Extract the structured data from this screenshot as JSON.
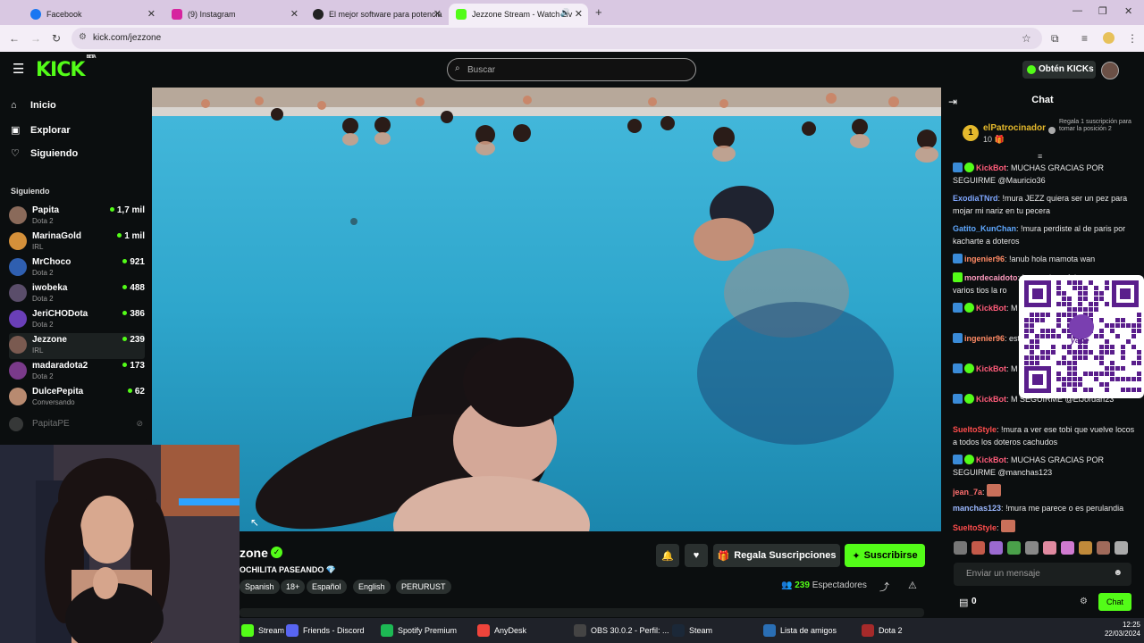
{
  "browser": {
    "tabs": [
      {
        "title": "Facebook",
        "color": "#1877f2"
      },
      {
        "title": "(9) Instagram",
        "color": "#d6249f"
      },
      {
        "title": "El mejor software para potencia",
        "color": "#222222"
      },
      {
        "title": "Jezzone Stream - Watch Liv",
        "color": "#53fc18"
      }
    ],
    "url": "kick.com/jezzone"
  },
  "header": {
    "logo": "KICK",
    "logo_badge": "BETA",
    "search_placeholder": "Buscar",
    "kicks_button": "Obtén KICKs"
  },
  "sidebar": {
    "nav": [
      {
        "label": "Inicio",
        "icon": "home-icon"
      },
      {
        "label": "Explorar",
        "icon": "compass-icon"
      },
      {
        "label": "Siguiendo",
        "icon": "heart-icon"
      }
    ],
    "following_title": "Siguiendo",
    "following": [
      {
        "name": "Papita",
        "category": "Dota 2",
        "viewers": "1,7 mil"
      },
      {
        "name": "MarinaGold",
        "category": "IRL",
        "viewers": "1 mil"
      },
      {
        "name": "MrChoco",
        "category": "Dota 2",
        "viewers": "921"
      },
      {
        "name": "iwobeka",
        "category": "Dota 2",
        "viewers": "488"
      },
      {
        "name": "JeriCHODota",
        "category": "Dota 2",
        "viewers": "386"
      },
      {
        "name": "Jezzone",
        "category": "IRL",
        "viewers": "239"
      },
      {
        "name": "madaradota2",
        "category": "Dota 2",
        "viewers": "173"
      },
      {
        "name": "DulcePepita",
        "category": "Conversando",
        "viewers": "62"
      }
    ],
    "offline": "PapitaPE"
  },
  "stream": {
    "channel": "zone",
    "title": "OCHILITA PASEANDO",
    "tags": [
      "Spanish",
      "18+",
      "Español",
      "English",
      "PERURUST"
    ],
    "gift_button": "Regala Suscripciones",
    "subscribe_button": "Suscribirse",
    "viewers": "239",
    "viewers_label": "Espectadores"
  },
  "chat": {
    "title": "Chat",
    "sponsor_rank": "1",
    "sponsor_name": "elPatrocinador",
    "sponsor_count": "10",
    "sponsor_note": "Regala 1 suscripción para tomar la posición 2",
    "messages": [
      {
        "user": "KickBot",
        "color": "#ff5c7a",
        "text": "MUCHAS GRACIAS POR SEGUIRME @Mauricio36"
      },
      {
        "user": "ExodiaTNrd",
        "color": "#7fa7ff",
        "text": "!mura JEZZ quiera ser un pez para mojar mi nariz en tu pecera"
      },
      {
        "user": "Gatito_KunChan",
        "color": "#5fa8ff",
        "text": "!mura perdiste al de paris por kacharte a doteros"
      },
      {
        "user": "ingenier96",
        "color": "#ff8a65",
        "text": "!anub hola mamota wan"
      },
      {
        "user": "mordecaidoto",
        "color": "#ff9cc0",
        "text": "!mura ahora falta que otra vez varios tios la ro"
      },
      {
        "user": "KickBot",
        "color": "#ff5c7a",
        "text": "M SEGUIRME @Heyn"
      },
      {
        "user": "ingenier96",
        "color": "#ff8a65",
        "text": "estas, perulandia?"
      },
      {
        "user": "KickBot",
        "color": "#ff5c7a",
        "text": "M SEGUIRME @Virus"
      },
      {
        "user": "KickBot",
        "color": "#ff5c7a",
        "text": "M SEGUIRME @ElJordan23"
      },
      {
        "user": "SueltoStyle",
        "color": "#ff4d4d",
        "text": "!mura a ver ese tobi que vuelve locos a todos los doteros cachudos"
      },
      {
        "user": "KickBot",
        "color": "#ff5c7a",
        "text": "MUCHAS GRACIAS POR SEGUIRME @manchas123"
      },
      {
        "user": "jean_7a",
        "color": "#ff6e6e",
        "text": ""
      },
      {
        "user": "manchas123",
        "color": "#9bb8ff",
        "text": "!mura me parece o es perulandia"
      },
      {
        "user": "SueltoStyle",
        "color": "#ff4d4d",
        "text": ""
      }
    ],
    "input_placeholder": "Enviar un mensaje",
    "points": "0",
    "send_button": "Chat",
    "qr_label": "yape"
  },
  "taskbar": {
    "items": [
      {
        "label": "Stream ...",
        "color": "#53fc18"
      },
      {
        "label": "Friends - Discord",
        "color": "#5865f2"
      },
      {
        "label": "Spotify Premium",
        "color": "#1db954"
      },
      {
        "label": "AnyDesk",
        "color": "#ef443b"
      },
      {
        "label": "OBS 30.0.2 - Perfil: ...",
        "color": "#444444"
      },
      {
        "label": "Steam",
        "color": "#1b2838"
      },
      {
        "label": "Lista de amigos",
        "color": "#2a6fb5"
      },
      {
        "label": "Dota 2",
        "color": "#a52a2a"
      }
    ],
    "time": "12:25",
    "date": "22/03/2024"
  },
  "colors": {
    "accent": "#53fc18",
    "background": "#0b0e0f",
    "panel": "#2a302f"
  }
}
